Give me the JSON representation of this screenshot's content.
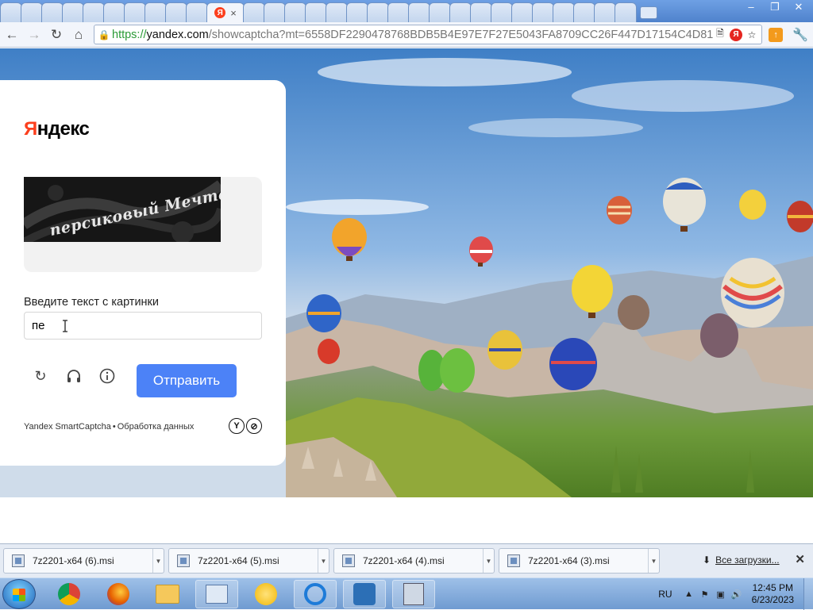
{
  "browser": {
    "tab_title_icon": "yandex-favicon",
    "tab_close": "×",
    "url": {
      "scheme": "https://",
      "host": "yandex.com",
      "path": "/showcaptcha?mt=6558DF2290478768BDB5B4E97E7F27E5043FA8709CC26F447D17154C4D81"
    },
    "window_buttons": [
      "–",
      "❐",
      "✕"
    ]
  },
  "captcha": {
    "logo_first": "Я",
    "logo_rest": "ндекс",
    "image_text": "персиковый Мечтает",
    "input_label": "Введите текст с картинки",
    "input_value": "пе",
    "submit_label": "Отправить",
    "footer_brand": "Yandex SmartCaptcha",
    "footer_sep": "•",
    "footer_link": "Обработка данных",
    "badges": [
      "Y",
      "⊘"
    ]
  },
  "downloads": {
    "items": [
      {
        "name": "7z2201-x64 (6).msi"
      },
      {
        "name": "7z2201-x64 (5).msi"
      },
      {
        "name": "7z2201-x64 (4).msi"
      },
      {
        "name": "7z2201-x64 (3).msi"
      }
    ],
    "all_label": "Все загрузки...",
    "close": "✕"
  },
  "taskbar": {
    "apps": [
      "chrome",
      "firefox",
      "file-explorer",
      "control-panel",
      "sunflower-app",
      "internet-explorer",
      "filezilla-like",
      "installer"
    ],
    "language": "RU",
    "time": "12:45 PM",
    "date": "6/23/2023"
  },
  "colors": {
    "yandex_red": "#fc3f1d",
    "submit_blue": "#4c82f7"
  }
}
